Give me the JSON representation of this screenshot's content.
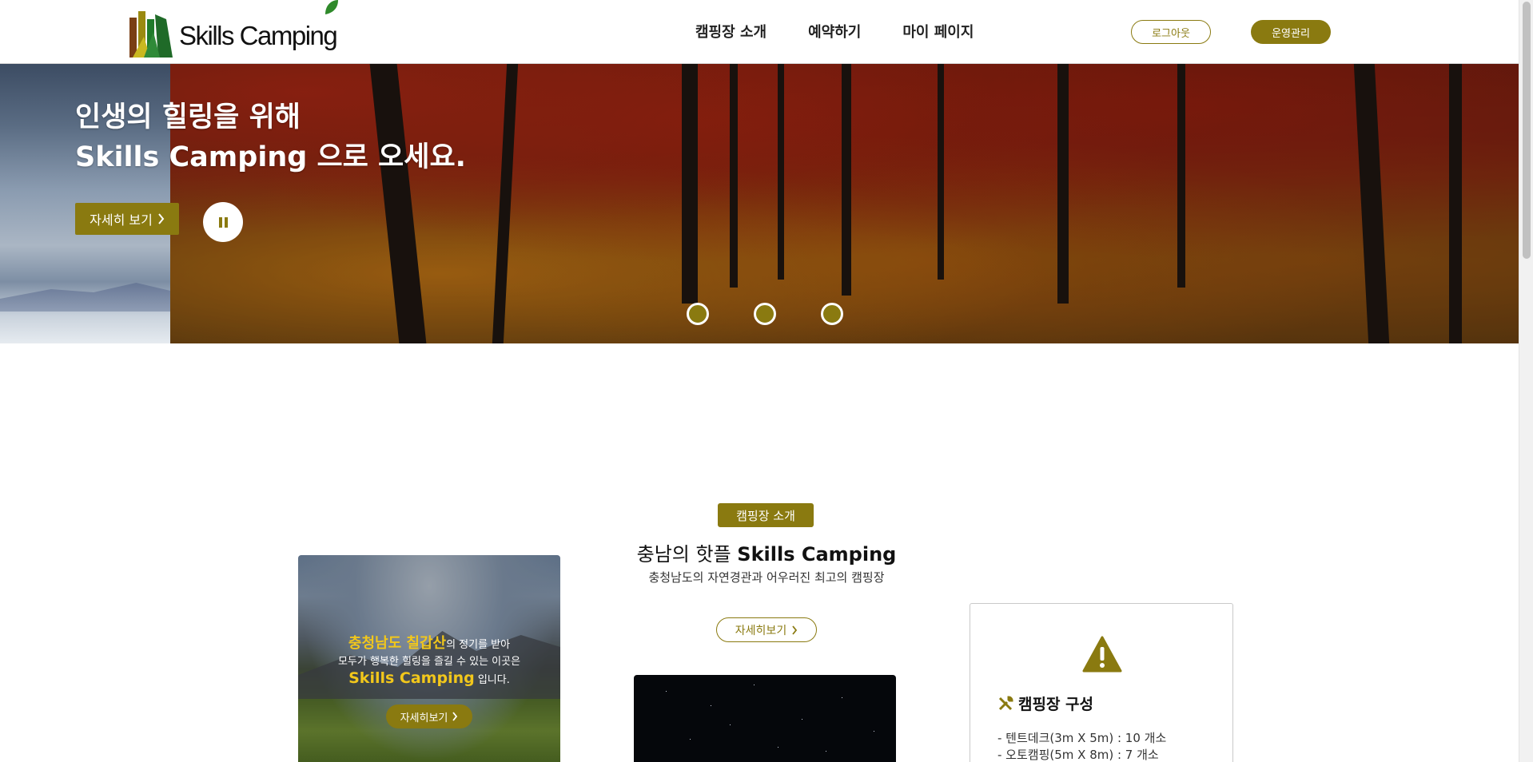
{
  "header": {
    "logo_text": "Skills Camping",
    "nav": [
      {
        "label": "캠핑장 소개"
      },
      {
        "label": "예약하기"
      },
      {
        "label": "마이 페이지"
      }
    ],
    "logout_label": "로그아웃",
    "admin_label": "운영관리"
  },
  "hero": {
    "title_line1": "인생의 힐링을 위해",
    "title_line2": "Skills Camping 으로 오세요.",
    "detail_button": "자세히 보기",
    "slide_count": 3
  },
  "intro": {
    "badge": "캠핑장 소개",
    "title_prefix": "충남의 핫플 ",
    "title_bold": "Skills Camping",
    "subtitle": "충청남도의 자연경관과 어우러진 최고의 캠핑장",
    "more_button": "자세히보기"
  },
  "promo_card": {
    "highlight": "충청남도 칠갑산",
    "line1_rest": "의 정기를 받아",
    "line2": "모두가 행복한 힐링을 즐길 수 있는 이곳은",
    "brand": "Skills Camping",
    "line3_rest": " 입니다.",
    "button": "자세히보기"
  },
  "info_card": {
    "title": "캠핑장 구성",
    "items": [
      "- 텐트데크(3m X 5m) : 10 개소",
      "- 오토캠핑(5m X 8m) : 7 개소"
    ]
  },
  "colors": {
    "accent": "#8a7a10",
    "highlight": "#f2c71b"
  }
}
